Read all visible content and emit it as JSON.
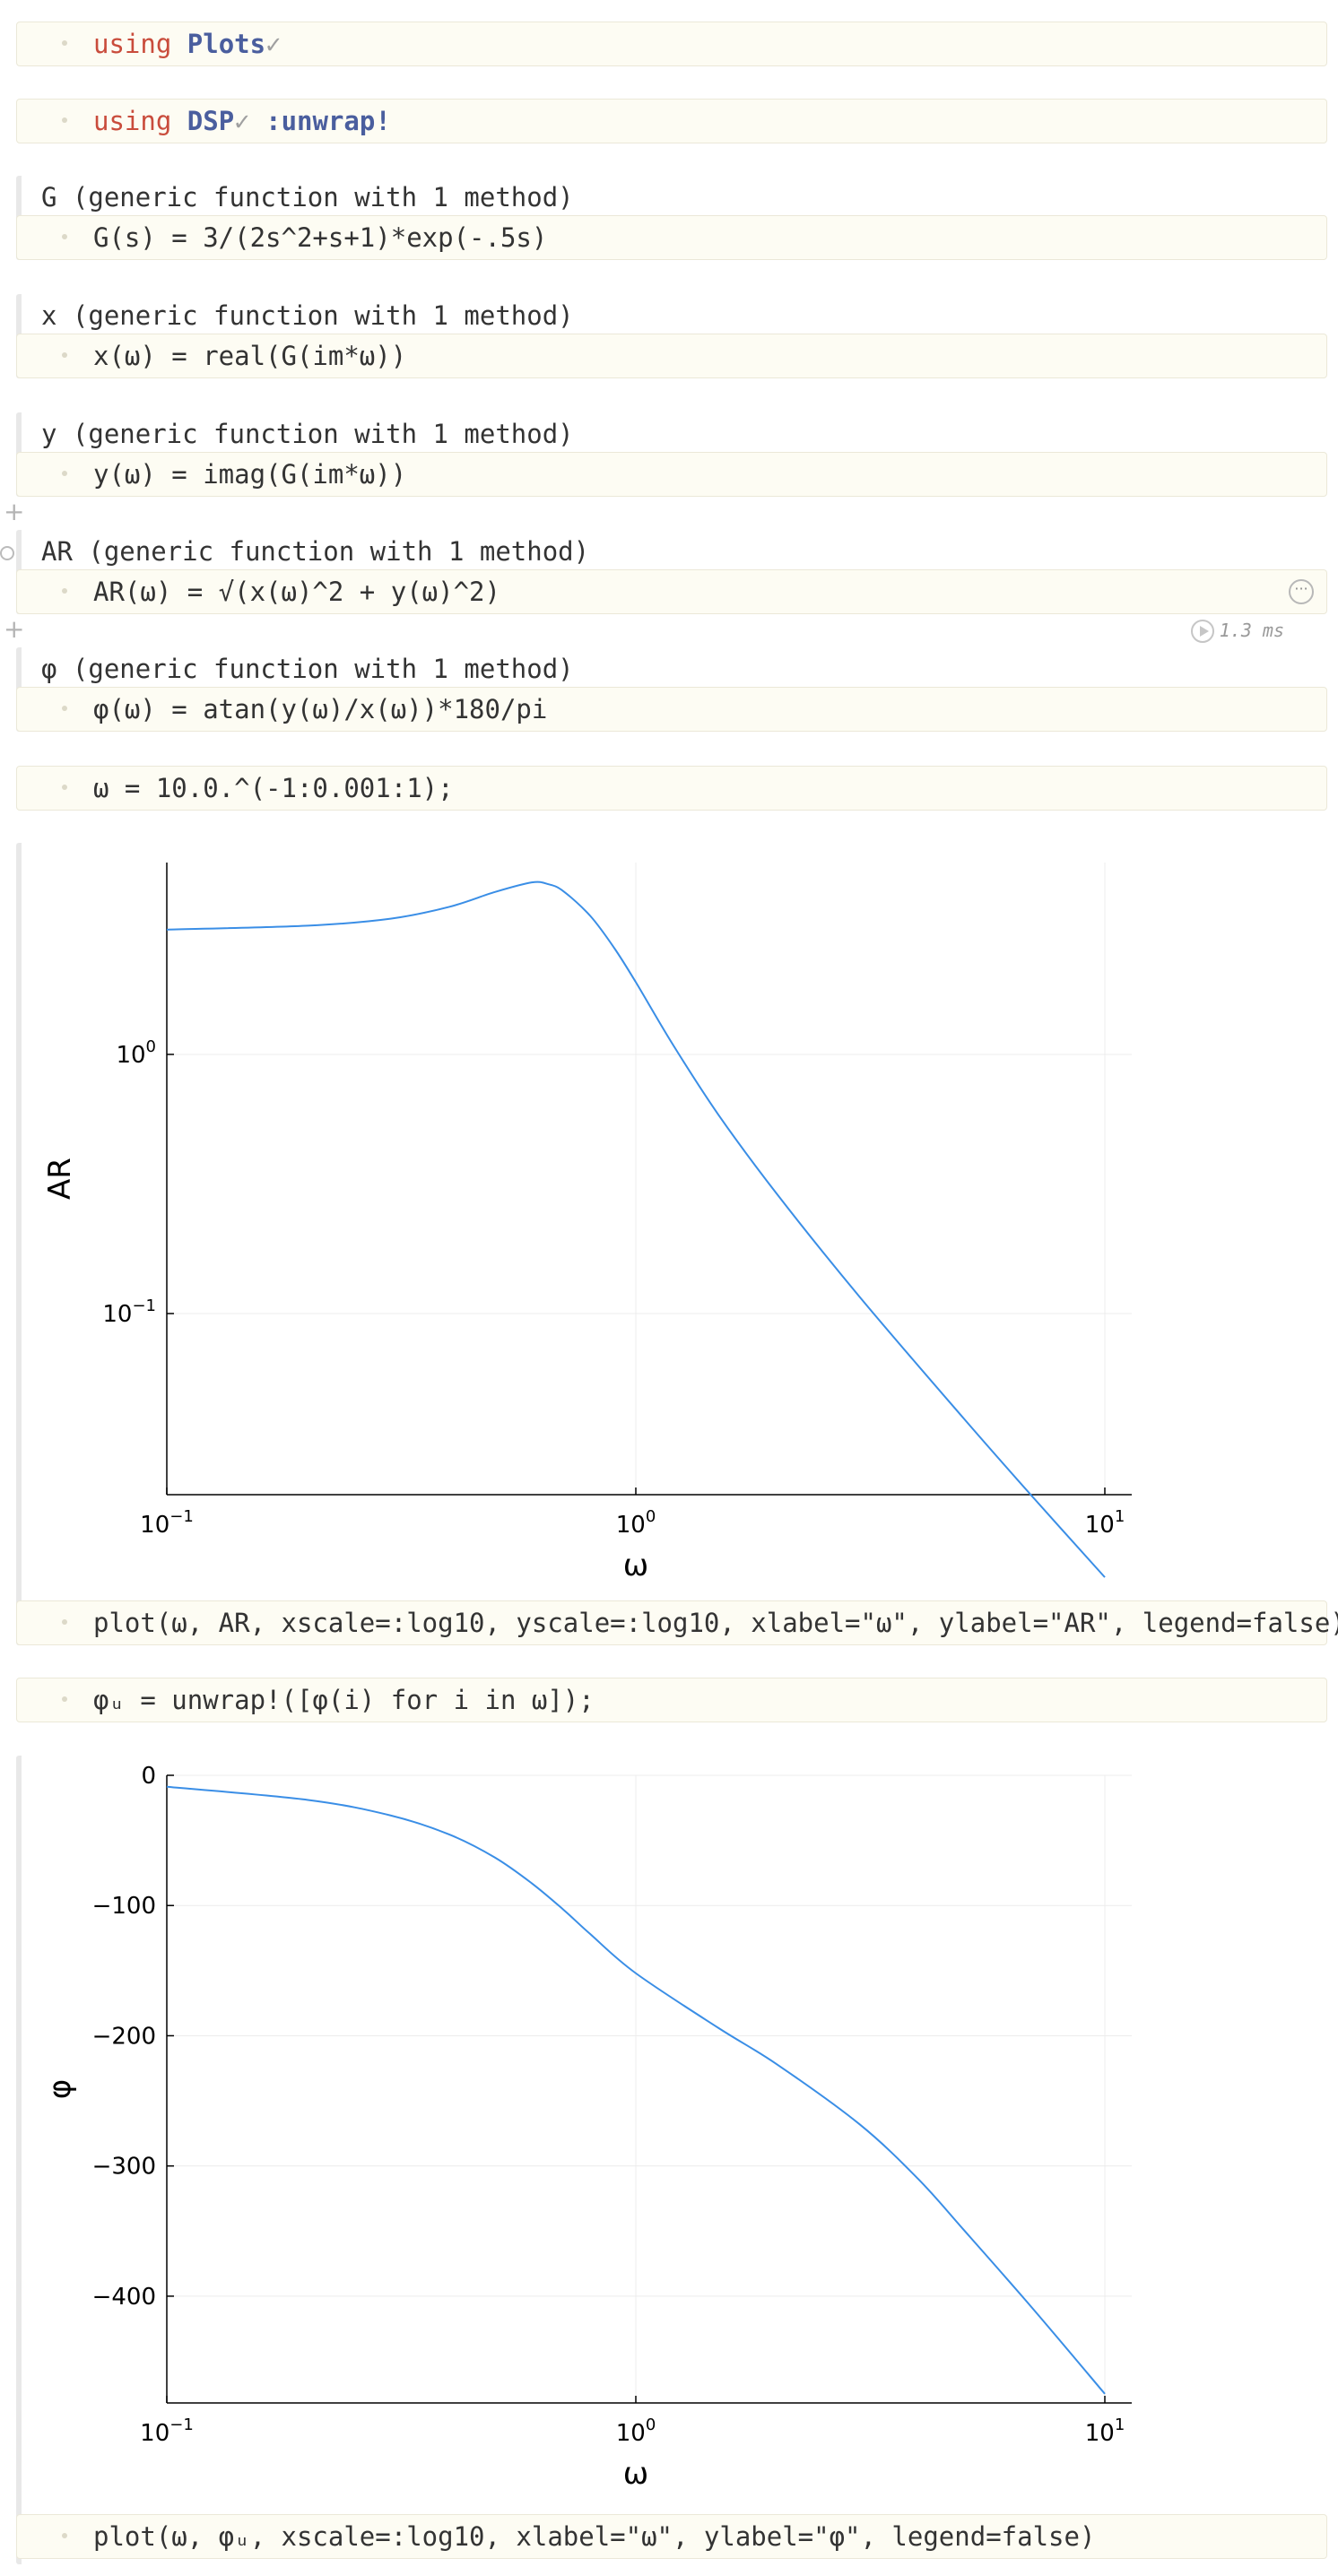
{
  "cells": {
    "c1": {
      "kw": "using",
      "pkg": "Plots",
      "check": "✓"
    },
    "c2": {
      "kw": "using",
      "pkg": "DSP",
      "check": "✓",
      "import": ":unwrap!"
    },
    "c3": {
      "output": "G (generic function with 1 method)",
      "code": "G(s) = 3/(2s^2+s+1)*exp(-.5s)"
    },
    "c4": {
      "output": "x (generic function with 1 method)",
      "code": "x(ω) = real(G(im*ω))"
    },
    "c5": {
      "output": "y (generic function with 1 method)",
      "code": "y(ω) = imag(G(im*ω))"
    },
    "c6": {
      "output": "AR (generic function with 1 method)",
      "code": "AR(ω) = √(x(ω)^2 + y(ω)^2)",
      "run_time": "1.3 ms"
    },
    "c7": {
      "output": "φ (generic function with 1 method)",
      "code": "φ(ω) = atan(y(ω)/x(ω))*180/pi"
    },
    "c8": {
      "code": "ω = 10.0.^(-1:0.001:1);"
    },
    "c9": {
      "code": "plot(ω, AR, xscale=:log10, yscale=:log10, xlabel=\"ω\", ylabel=\"AR\", legend=false)"
    },
    "c10": {
      "code": "φᵤ = unwrap!([φ(i) for i in ω]);"
    },
    "c11": {
      "code": "plot(ω, φᵤ, xscale=:log10, xlabel=\"ω\", ylabel=\"φ\", legend=false)"
    }
  },
  "icons": {
    "add_cell": "plus-icon",
    "run": "play-icon",
    "more": "ellipsis-icon",
    "visibility": "eye-icon"
  },
  "colors": {
    "series": "#3a8ee6",
    "grid": "#ececec",
    "code_bg": "#fdfcf3",
    "keyword": "#c94c3c",
    "identifier": "#4a5e9e",
    "number": "#7a53a0",
    "string": "#c0551b"
  },
  "chart_data": [
    {
      "type": "line",
      "title": "",
      "xlabel": "ω",
      "ylabel": "AR",
      "xscale": "log10",
      "yscale": "log10",
      "grid": true,
      "legend": false,
      "xlim": [
        0.1,
        10
      ],
      "ylim": [
        0.02,
        5.5
      ],
      "x_ticks": [
        {
          "base": "10",
          "exp": "−1"
        },
        {
          "base": "10",
          "exp": "0"
        },
        {
          "base": "10",
          "exp": "1"
        }
      ],
      "y_ticks": [
        {
          "base": "10",
          "exp": "−1"
        },
        {
          "base": "10",
          "exp": "0"
        }
      ],
      "x_tick_values": [
        0.1,
        1,
        10
      ],
      "y_tick_values": [
        0.1,
        1
      ],
      "series": [
        {
          "x": [
            0.1,
            0.2,
            0.3,
            0.4,
            0.5,
            0.6,
            0.65,
            0.7,
            0.8,
            0.9,
            1.0,
            1.2,
            1.5,
            2,
            3,
            5,
            7,
            10
          ],
          "y": [
            3.03,
            3.14,
            3.34,
            3.71,
            4.23,
            4.61,
            4.54,
            4.27,
            3.42,
            2.57,
            1.9,
            1.09,
            0.585,
            0.289,
            0.116,
            0.0394,
            0.0197,
            0.0096
          ]
        }
      ]
    },
    {
      "type": "line",
      "title": "",
      "xlabel": "ω",
      "ylabel": "φ",
      "xscale": "log10",
      "grid": true,
      "legend": false,
      "xlim": [
        0.1,
        10
      ],
      "ylim": [
        -482,
        0
      ],
      "x_ticks": [
        {
          "base": "10",
          "exp": "−1"
        },
        {
          "base": "10",
          "exp": "0"
        },
        {
          "base": "10",
          "exp": "1"
        }
      ],
      "x_tick_values": [
        0.1,
        1,
        10
      ],
      "y_ticks": [
        "0",
        "−100",
        "−200",
        "−300",
        "−400"
      ],
      "y_tick_values": [
        0,
        -100,
        -200,
        -300,
        -400
      ],
      "series": [
        {
          "x": [
            0.1,
            0.2,
            0.3,
            0.4,
            0.5,
            0.6,
            0.7,
            0.8,
            1.0,
            1.5,
            2,
            3,
            4,
            5,
            7,
            10
          ],
          "y": [
            -8.8,
            -18.9,
            -30.8,
            -45.4,
            -63.0,
            -82.9,
            -103,
            -122,
            -152,
            -194,
            -222,
            -268,
            -310,
            -349,
            -409,
            -475
          ]
        }
      ]
    }
  ]
}
